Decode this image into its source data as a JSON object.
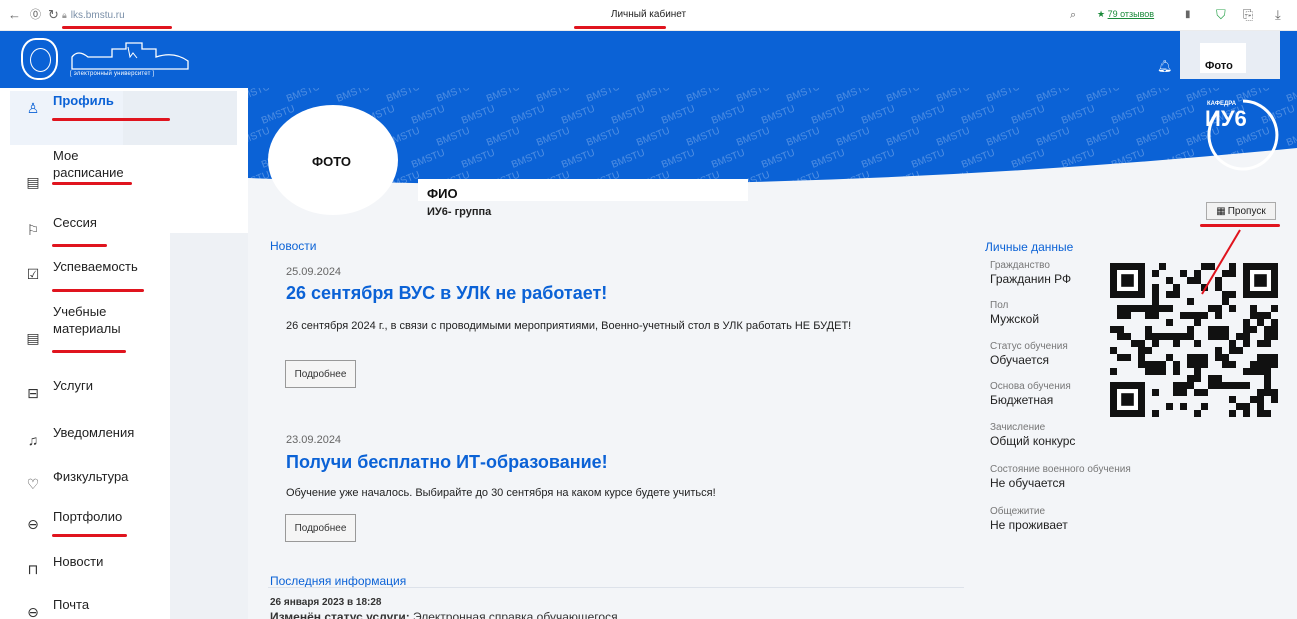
{
  "browser": {
    "url": "lks.bmstu.ru",
    "title": "Личный кабинет",
    "reviews": "79 отзывов"
  },
  "header": {
    "logo_caption": "[ электронный университет ]",
    "photo_label": "Фото"
  },
  "sidebar": {
    "items": [
      {
        "label": "Профиль",
        "icon": "user-icon",
        "active": true
      },
      {
        "label": "Мое\nрасписание",
        "icon": "calendar-icon"
      },
      {
        "label": "Сессия",
        "icon": "flag-icon"
      },
      {
        "label": "Успеваемость",
        "icon": "checkbox-icon"
      },
      {
        "label": "Учебные\nматериалы",
        "icon": "document-icon"
      },
      {
        "label": "Услуги",
        "icon": "briefcase-icon"
      },
      {
        "label": "Уведомления",
        "icon": "bell-icon"
      },
      {
        "label": "Физкультура",
        "icon": "heart-icon"
      },
      {
        "label": "Портфолио",
        "icon": "portfolio-icon"
      },
      {
        "label": "Новости",
        "icon": "bookmark-icon"
      },
      {
        "label": "Почта",
        "icon": "mail-icon"
      }
    ]
  },
  "banner": {
    "watermark": "BMSTU",
    "kafedra_small": "КАФЕДРА",
    "kafedra_name": "ИУ6"
  },
  "profile": {
    "photo_label": "ФОТО",
    "fio": "ФИО",
    "group": "ИУ6- группа",
    "pass_button": "Пропуск"
  },
  "news": {
    "section_title": "Новости",
    "items": [
      {
        "date": "25.09.2024",
        "title": "26 сентября ВУС в УЛК не работает!",
        "text": "26 сентября 2024 г., в связи с проводимыми мероприятиями, Военно-учетный стол в УЛК работать НЕ БУДЕТ!",
        "button": "Подробнее"
      },
      {
        "date": "23.09.2024",
        "title": "Получи бесплатно ИТ-образование!",
        "text": "Обучение уже началось. Выбирайте до 30 сентября на каком курсе будете учиться!",
        "button": "Подробнее"
      }
    ]
  },
  "last_info": {
    "section_title": "Последняя информация",
    "date": "26 января 2023 в 18:28",
    "bold": "Изменён статус услуги:",
    "text": " Электронная справка обучающегося"
  },
  "personal": {
    "section_title": "Личные данные",
    "fields": [
      {
        "label": "Гражданство",
        "value": "Гражданин РФ"
      },
      {
        "label": "Пол",
        "value": "Мужской"
      },
      {
        "label": "Статус обучения",
        "value": "Обучается"
      },
      {
        "label": "Основа обучения",
        "value": "Бюджетная"
      },
      {
        "label": "Зачисление",
        "value": "Общий конкурс"
      },
      {
        "label": "Состояние военного обучения",
        "value": "Не обучается"
      },
      {
        "label": "Общежитие",
        "value": "Не проживает"
      }
    ]
  },
  "colors": {
    "brand": "#0b62d6",
    "annotation": "#e0141e"
  }
}
